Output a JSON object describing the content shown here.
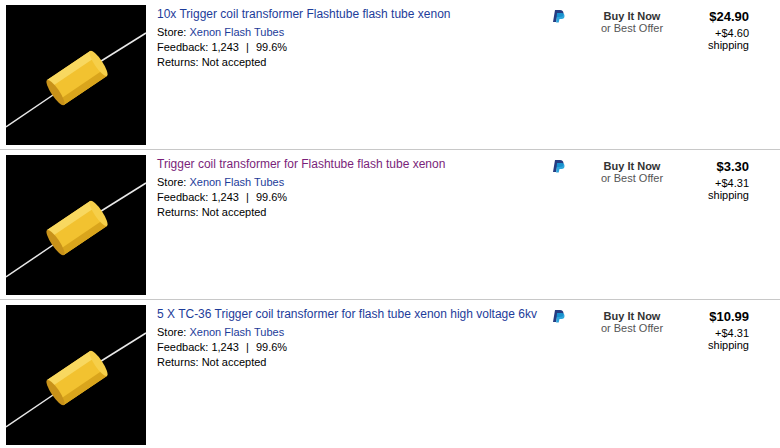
{
  "listings": [
    {
      "title": "10x Trigger coil transformer Flashtube flash tube xenon",
      "visited": false,
      "store_label": "Store:",
      "store": "Xenon Flash Tubes",
      "feedback_label": "Feedback:",
      "feedback_count": "1,243",
      "separator": "|",
      "feedback_percent": "99.6%",
      "returns_label": "Returns:",
      "returns": "Not accepted",
      "format": "Buy It Now",
      "offer": "or Best Offer",
      "price": "$24.90",
      "shipping_cost": "+$4.60",
      "shipping_label": "shipping"
    },
    {
      "title": "Trigger coil transformer for Flashtube flash tube xenon",
      "visited": true,
      "store_label": "Store:",
      "store": "Xenon Flash Tubes",
      "feedback_label": "Feedback:",
      "feedback_count": "1,243",
      "separator": "|",
      "feedback_percent": "99.6%",
      "returns_label": "Returns:",
      "returns": "Not accepted",
      "format": "Buy It Now",
      "offer": "or Best Offer",
      "price": "$3.30",
      "shipping_cost": "+$4.31",
      "shipping_label": "shipping"
    },
    {
      "title": "5 X TC-36 Trigger coil transformer for flash tube xenon high voltage 6kv",
      "visited": false,
      "store_label": "Store:",
      "store": "Xenon Flash Tubes",
      "feedback_label": "Feedback:",
      "feedback_count": "1,243",
      "separator": "|",
      "feedback_percent": "99.6%",
      "returns_label": "Returns:",
      "returns": "Not accepted",
      "format": "Buy It Now",
      "offer": "or Best Offer",
      "price": "$10.99",
      "shipping_cost": "+$4.31",
      "shipping_label": "shipping"
    }
  ]
}
